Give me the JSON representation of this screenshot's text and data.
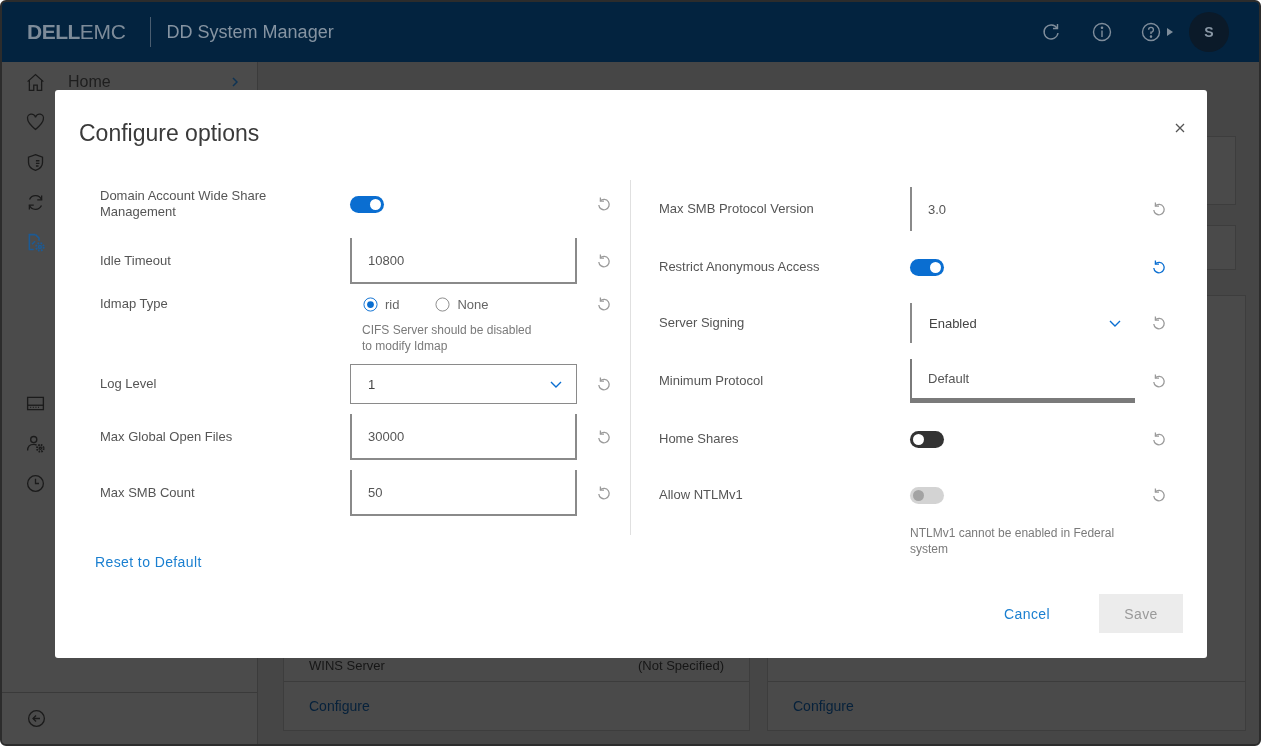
{
  "header": {
    "logo": "**DELL**EMC",
    "title": "DD System Manager",
    "avatar": "S"
  },
  "sidebar": {
    "items": [
      {
        "label": "Home",
        "selected": false
      },
      {
        "selected": false
      },
      {
        "selected": false
      },
      {
        "selected": false
      },
      {
        "selected": true
      }
    ],
    "lower_items": [
      {
        "selected": false
      },
      {
        "selected": false
      },
      {
        "selected": false
      }
    ]
  },
  "background_cards": [
    {
      "rows": [
        {
          "name": "WINS Server",
          "value": "(Not Specified)"
        }
      ],
      "link": "Configure"
    },
    {
      "link": "Configure"
    }
  ],
  "dialog": {
    "title": "Configure options",
    "columns": [
      [
        {
          "kind": "toggle",
          "label": "Domain Account Wide Share Management",
          "on": true,
          "disabled": false,
          "changed": false
        },
        {
          "kind": "text",
          "label": "Idle Timeout",
          "value": "10800",
          "focused": false,
          "changed": false
        },
        {
          "kind": "radio",
          "label": "Idmap Type",
          "options": [
            {
              "label": "rid",
              "selected": true
            },
            {
              "label": "None",
              "selected": false
            }
          ],
          "help": "CIFS Server should be disabled to modify Idmap",
          "changed": false
        },
        {
          "kind": "select",
          "label": "Log Level",
          "value": "1",
          "changed": false
        },
        {
          "kind": "text",
          "label": "Max Global Open Files",
          "value": "30000",
          "focused": false,
          "changed": false
        },
        {
          "kind": "text",
          "label": "Max SMB Count",
          "value": "50",
          "focused": false,
          "changed": false
        }
      ],
      [
        {
          "kind": "text",
          "label": "Max SMB Protocol Version",
          "value": "3.0",
          "focused": false,
          "changed": false
        },
        {
          "kind": "toggle",
          "label": "Restrict Anonymous Access",
          "on": true,
          "disabled": false,
          "changed": true
        },
        {
          "kind": "select",
          "label": "Server Signing",
          "value": "Enabled",
          "changed": false
        },
        {
          "kind": "text",
          "label": "Minimum Protocol",
          "value": "Default",
          "focused": true,
          "changed": false
        },
        {
          "kind": "toggle",
          "label": "Home Shares",
          "on": false,
          "disabled": false,
          "changed": false
        },
        {
          "kind": "toggle",
          "label": "Allow NTLMv1",
          "on": false,
          "disabled": true,
          "help": "NTLMv1 cannot be enabled in Federal system",
          "changed": false
        }
      ]
    ],
    "reset_link": "Reset to Default",
    "buttons": [
      {
        "label": "Cancel",
        "kind": "link",
        "disabled": false
      },
      {
        "label": "Save",
        "kind": "primary",
        "disabled": true
      }
    ]
  }
}
